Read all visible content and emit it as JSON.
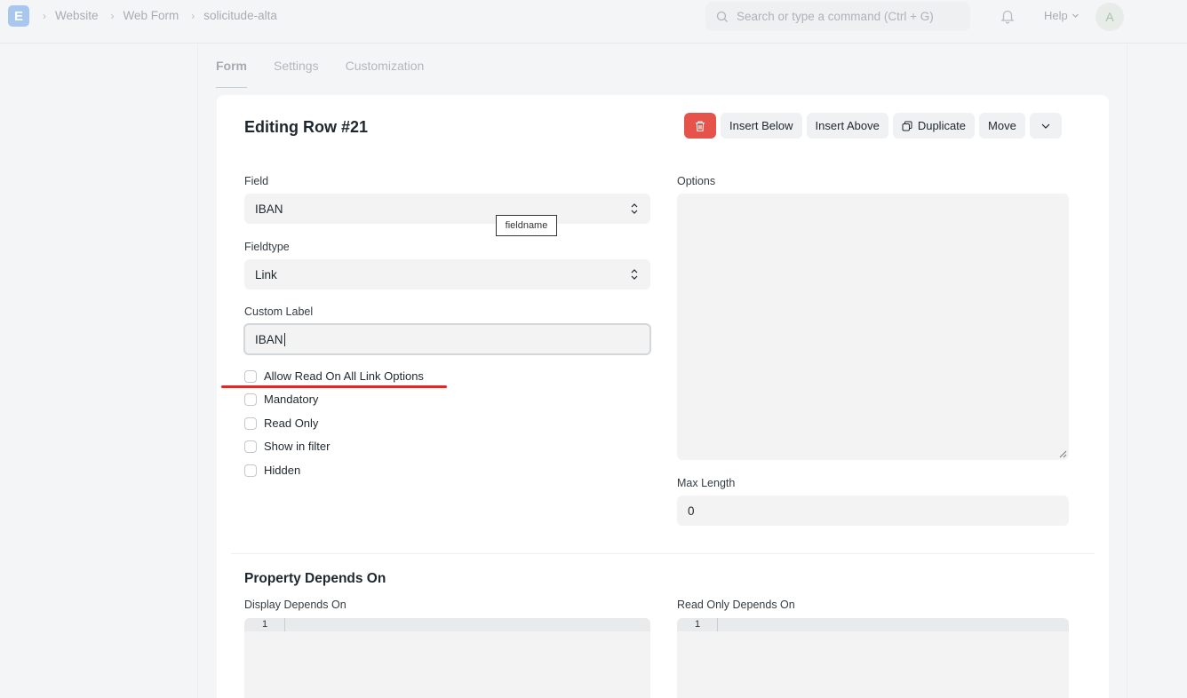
{
  "navbar": {
    "logo": "E",
    "breadcrumbs": [
      "Website",
      "Web Form",
      "solicitude-alta"
    ],
    "search_placeholder": "Search or type a command (Ctrl + G)",
    "help_label": "Help",
    "avatar_initial": "A"
  },
  "tabs": [
    "Form",
    "Settings",
    "Customization"
  ],
  "editor": {
    "title": "Editing Row #21",
    "actions": {
      "insert_below": "Insert Below",
      "insert_above": "Insert Above",
      "duplicate": "Duplicate",
      "move": "Move"
    },
    "field_label": "Field",
    "field_value": "IBAN",
    "tooltip": "fieldname",
    "fieldtype_label": "Fieldtype",
    "fieldtype_value": "Link",
    "custom_label_label": "Custom Label",
    "custom_label_value": "IBAN",
    "checkboxes": [
      "Allow Read On All Link Options",
      "Mandatory",
      "Read Only",
      "Show in filter",
      "Hidden"
    ],
    "options_label": "Options",
    "max_length_label": "Max Length",
    "max_length_value": "0",
    "section_title": "Property Depends On",
    "display_depends_label": "Display Depends On",
    "read_only_depends_label": "Read Only Depends On",
    "line_number": "1"
  },
  "colors": {
    "danger": "#e5534b",
    "annotation_line": "#e52628"
  }
}
